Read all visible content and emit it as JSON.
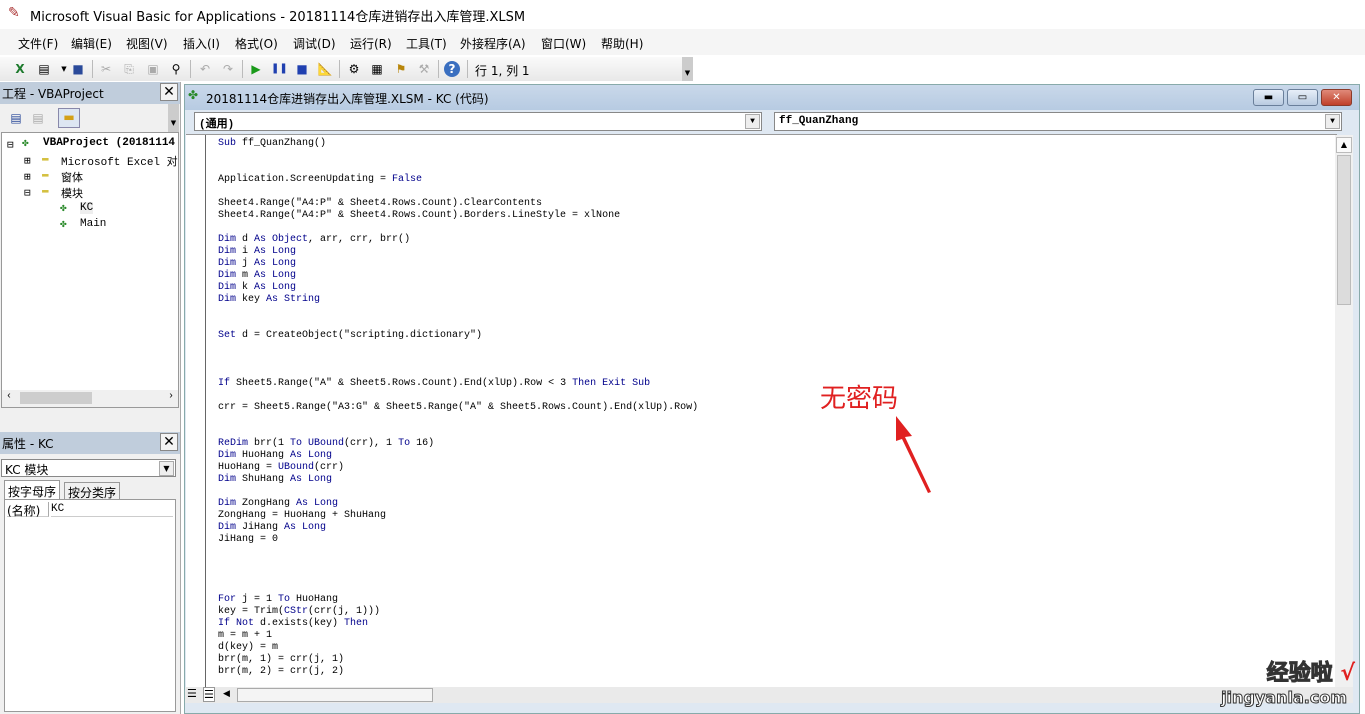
{
  "window": {
    "title": "Microsoft Visual Basic for Applications - 20181114仓库进销存出入库管理.XLSM"
  },
  "menu": [
    "文件(F)",
    "编辑(E)",
    "视图(V)",
    "插入(I)",
    "格式(O)",
    "调试(D)",
    "运行(R)",
    "工具(T)",
    "外接程序(A)",
    "窗口(W)",
    "帮助(H)"
  ],
  "toolbar": {
    "position": "行 1, 列 1"
  },
  "project": {
    "title": "工程 - VBAProject",
    "root": "VBAProject (20181114",
    "nodes": [
      "Microsoft Excel 对象",
      "窗体",
      "模块"
    ],
    "modules": [
      "KC",
      "Main"
    ]
  },
  "properties": {
    "title": "属性 - KC",
    "object": "KC 模块",
    "tabs": [
      "按字母序",
      "按分类序"
    ],
    "name_label": "(名称)",
    "name_value": "KC"
  },
  "codewindow": {
    "title": "20181114仓库进销存出入库管理.XLSM - KC (代码)",
    "object_combo": "(通用)",
    "proc_combo": "ff_QuanZhang"
  },
  "code": [
    [
      [
        "Sub",
        "k"
      ],
      [
        " ff_QuanZhang()",
        ""
      ]
    ],
    [],
    [],
    [
      [
        "Application.ScreenUpdating = ",
        ""
      ],
      [
        "False",
        "k"
      ]
    ],
    [],
    [
      [
        "Sheet4.Range(\"A4:P\" & Sheet4.Rows.Count).ClearContents",
        ""
      ]
    ],
    [
      [
        "Sheet4.Range(\"A4:P\" & Sheet4.Rows.Count).Borders.LineStyle = xlNone",
        ""
      ]
    ],
    [],
    [
      [
        "Dim",
        "k"
      ],
      [
        " d ",
        ""
      ],
      [
        "As Object",
        "k"
      ],
      [
        ", arr, crr, brr()",
        ""
      ]
    ],
    [
      [
        "Dim",
        "k"
      ],
      [
        " i ",
        ""
      ],
      [
        "As Long",
        "k"
      ]
    ],
    [
      [
        "Dim",
        "k"
      ],
      [
        " j ",
        ""
      ],
      [
        "As Long",
        "k"
      ]
    ],
    [
      [
        "Dim",
        "k"
      ],
      [
        " m ",
        ""
      ],
      [
        "As Long",
        "k"
      ]
    ],
    [
      [
        "Dim",
        "k"
      ],
      [
        " k ",
        ""
      ],
      [
        "As Long",
        "k"
      ]
    ],
    [
      [
        "Dim",
        "k"
      ],
      [
        " key ",
        ""
      ],
      [
        "As String",
        "k"
      ]
    ],
    [],
    [],
    [
      [
        "Set",
        "k"
      ],
      [
        " d = CreateObject(\"scripting.dictionary\")",
        ""
      ]
    ],
    [],
    [],
    [],
    [
      [
        "If",
        "k"
      ],
      [
        " Sheet5.Range(\"A\" & Sheet5.Rows.Count).End(xlUp).Row < 3 ",
        ""
      ],
      [
        "Then Exit Sub",
        "k"
      ]
    ],
    [],
    [
      [
        "crr = Sheet5.Range(\"A3:G\" & Sheet5.Range(\"A\" & Sheet5.Rows.Count).End(xlUp).Row)",
        ""
      ]
    ],
    [],
    [],
    [
      [
        "ReDim",
        "k"
      ],
      [
        " brr(1 ",
        ""
      ],
      [
        "To UBound",
        "k"
      ],
      [
        "(crr), 1 ",
        ""
      ],
      [
        "To",
        "k"
      ],
      [
        " 16)",
        ""
      ]
    ],
    [
      [
        "Dim",
        "k"
      ],
      [
        " HuoHang ",
        ""
      ],
      [
        "As Long",
        "k"
      ]
    ],
    [
      [
        "HuoHang = ",
        ""
      ],
      [
        "UBound",
        "k"
      ],
      [
        "(crr)",
        ""
      ]
    ],
    [
      [
        "Dim",
        "k"
      ],
      [
        " ShuHang ",
        ""
      ],
      [
        "As Long",
        "k"
      ]
    ],
    [],
    [
      [
        "Dim",
        "k"
      ],
      [
        " ZongHang ",
        ""
      ],
      [
        "As Long",
        "k"
      ]
    ],
    [
      [
        "ZongHang = HuoHang + ShuHang",
        ""
      ]
    ],
    [
      [
        "Dim",
        "k"
      ],
      [
        " JiHang ",
        ""
      ],
      [
        "As Long",
        "k"
      ]
    ],
    [
      [
        "JiHang = 0",
        ""
      ]
    ],
    [],
    [],
    [],
    [],
    [
      [
        "For",
        "k"
      ],
      [
        " j = 1 ",
        ""
      ],
      [
        "To",
        "k"
      ],
      [
        " HuoHang",
        ""
      ]
    ],
    [
      [
        "key = Trim(",
        ""
      ],
      [
        "CStr",
        "k"
      ],
      [
        "(crr(j, 1)))",
        ""
      ]
    ],
    [
      [
        "If Not",
        "k"
      ],
      [
        " d.exists(key) ",
        ""
      ],
      [
        "Then",
        "k"
      ]
    ],
    [
      [
        "m = m + 1",
        ""
      ]
    ],
    [
      [
        "d(key) = m",
        ""
      ]
    ],
    [
      [
        "brr(m, 1) = crr(j, 1)",
        ""
      ]
    ],
    [
      [
        "brr(m, 2) = crr(j, 2)",
        ""
      ]
    ]
  ],
  "annotation": "无密码",
  "watermark": {
    "text": "经验啦",
    "url": "jingyanla.com"
  },
  "colors": {
    "keyword": "#00008b",
    "annotation": "#e02020",
    "titlebar": "#c9d8ea"
  }
}
